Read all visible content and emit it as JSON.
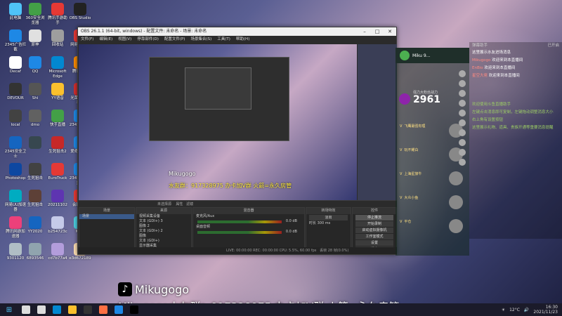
{
  "desktop": {
    "icons": [
      {
        "label": "此电脑",
        "color": "#4fc3f7"
      },
      {
        "label": "360安全浏览器",
        "color": "#43a047"
      },
      {
        "label": "腾讯手游助手",
        "color": "#e53935"
      },
      {
        "label": "OBS Studio",
        "color": "#222222"
      },
      {
        "label": "2345广告拦截",
        "color": "#1e88e5"
      },
      {
        "label": "原神",
        "color": "#e0e0e0"
      },
      {
        "label": "回收站",
        "color": "#9e9e9e"
      },
      {
        "label": "网易云音乐",
        "color": "#e53935"
      },
      {
        "label": "Decaf",
        "color": "#ffffff"
      },
      {
        "label": "QQ",
        "color": "#1e88e5"
      },
      {
        "label": "Microsoft Edge",
        "color": "#0288d1"
      },
      {
        "label": "腾讯游戏",
        "color": "#fb8c00"
      },
      {
        "label": "DEVOUR",
        "color": "#333333"
      },
      {
        "label": "Shi",
        "color": "#555555"
      },
      {
        "label": "YY语音",
        "color": "#fbc02d"
      },
      {
        "label": "光荣世界组平台",
        "color": "#d32f2f"
      },
      {
        "label": "local",
        "color": "#424242"
      },
      {
        "label": "dmo",
        "color": "#616161"
      },
      {
        "label": "快手直播",
        "color": "#43a047"
      },
      {
        "label": "2345安全卫士",
        "color": "#1e88e5"
      },
      {
        "label": "2345安全卫士",
        "color": "#1565c0"
      },
      {
        "label": "",
        "color": "#37474f"
      },
      {
        "label": "生死狙击2",
        "color": "#c62828"
      },
      {
        "label": "爱奇艺桌面",
        "color": "#1e88e5"
      },
      {
        "label": "Photoshop",
        "color": "#0d47a1"
      },
      {
        "label": "生死狙击",
        "color": "#424242"
      },
      {
        "label": "EuroTruck",
        "color": "#e53935"
      },
      {
        "label": "2345加速浏览器",
        "color": "#1e88e5"
      },
      {
        "label": "网易UU加速器",
        "color": "#00acc1"
      },
      {
        "label": "生死狙击",
        "color": "#5d4037"
      },
      {
        "label": "20211102",
        "color": "#5e35b1"
      },
      {
        "label": "会玩手游",
        "color": "#e53935"
      },
      {
        "label": "腾讯网游加速器",
        "color": "#ec407a"
      },
      {
        "label": "YY2020",
        "color": "#1565c0"
      },
      {
        "label": "b254723c",
        "color": "#c5cae9"
      },
      {
        "label": "Miku",
        "color": "#4dd0e1"
      },
      {
        "label": "9301120",
        "color": "#b0bec5"
      },
      {
        "label": "6893546",
        "color": "#90a4ae"
      },
      {
        "label": "cd7b77a4",
        "color": "#b39ddb"
      },
      {
        "label": "e3d672189",
        "color": "#ffe0b2"
      }
    ]
  },
  "obs": {
    "title": "OBS 26.1.1 (64-bit, windows) - 配置文件: 未命名 - 场景: 未命名",
    "menu": [
      "文件(F)",
      "编辑(E)",
      "视图(V)",
      "停靠部件(D)",
      "配置文件(P)",
      "场景集合(S)",
      "工具(T)",
      "帮助(H)"
    ],
    "preview_overlay_name": "Mikugogo",
    "preview_overlay_promo": "水友群：917328975 办卡加V群 火箭=永久房管",
    "scene_bar": "未选择源",
    "scene_tabs": [
      "属性",
      "滤镜"
    ],
    "docks": {
      "scenes": {
        "title": "场景",
        "items": [
          "场景"
        ]
      },
      "sources": {
        "title": "来源",
        "items": [
          "视频采集设备",
          "文本 (GDI+) 3",
          "图像 2",
          "文本 (GDI+) 2",
          "图像",
          "文本 (GDI+)",
          "显示器采集"
        ]
      },
      "mixer": {
        "title": "混音器",
        "channels": [
          {
            "name": "麦克风/Aux",
            "db": "0.0 dB"
          },
          {
            "name": "桌面音频",
            "db": "0.0 dB"
          }
        ]
      },
      "transitions": {
        "title": "转场特效",
        "type": "淡出",
        "duration_label": "时长",
        "duration": "300 ms"
      },
      "controls": {
        "title": "控件",
        "buttons": [
          "停止推流",
          "开始录制",
          "启动虚拟摄像机",
          "工作室模式",
          "设置",
          "退出"
        ]
      }
    },
    "status": "LIVE: 00:00:00   REC: 00:00:00   CPU: 5.5%, 60.00 fps",
    "status_extra": "丢帧 28 帧(0.0%)"
  },
  "live_panel": {
    "streamer_name": "Miku 9...",
    "level_label": "强力大粉丝战力",
    "score": "2961",
    "fans": [
      {
        "label": "飞鹰最强有理",
        "level": "V"
      },
      {
        "label": "玩不耀白",
        "level": "V"
      },
      {
        "label": "上海星旅牛",
        "level": "V"
      },
      {
        "label": "大众小鱼",
        "level": "V"
      },
      {
        "label": "平仓",
        "level": "V"
      }
    ]
  },
  "chat": {
    "header_left": "弹幕助手",
    "header_right": "已开启",
    "lines": [
      {
        "text": "这里展示水友进场消息"
      },
      {
        "name": "Mikugogo",
        "text": "欢迎来到本直播间"
      },
      {
        "name": "EnBio",
        "text": "欢迎来到本直播间"
      },
      {
        "name": "星空大佬",
        "text": "欢迎来到本直播间"
      }
    ],
    "notices": [
      "欢迎使用斗鱼直播助手",
      "左键点击消息即可复制，左键拖动调整消息大小",
      "右上角有设置按钮",
      "这里展示礼物、道具、贵族开通等重要消息提醒"
    ]
  },
  "overlay": {
    "name": "Mikugogo",
    "promo": "Mikugogo水友群：917328975 办卡加V群 火箭=永久房管"
  },
  "taskbar": {
    "temperature": "12°C",
    "time": "16:30",
    "date": "2021/11/23",
    "apps": [
      {
        "name": "start",
        "color": "#4fc3f7"
      },
      {
        "name": "search",
        "color": "#dddddd"
      },
      {
        "name": "task-view",
        "color": "#dddddd"
      },
      {
        "name": "edge",
        "color": "#0288d1"
      },
      {
        "name": "explorer",
        "color": "#fbc02d"
      },
      {
        "name": "obs",
        "color": "#333333"
      },
      {
        "name": "doyu",
        "color": "#ff7043"
      },
      {
        "name": "qq",
        "color": "#1e88e5"
      },
      {
        "name": "tiktok",
        "color": "#000000"
      }
    ]
  }
}
